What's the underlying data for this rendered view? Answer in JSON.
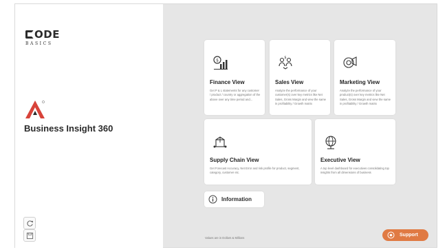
{
  "sidebar": {
    "logo_top": "ODE",
    "logo_bottom": "BASICS",
    "brand_title": "Business Insight 360"
  },
  "cards": {
    "finance": {
      "title": "Finance View",
      "description": "Get P & L statements for any customer / product / country or aggregation of the above over any time period and..."
    },
    "sales": {
      "title": "Sales View",
      "description": "Analyze the performance of your customer(s) over key metrics like Net Sales, Gross Margin and view the same in profitability / Growth matrix"
    },
    "marketing": {
      "title": "Marketing View",
      "description": "Analyze the performance of your product(s) over key metrics like Net Sales, Gross Margin and view the same in profitability / Growth matrix"
    },
    "supply_chain": {
      "title": "Supply Chain View",
      "description": "Get Forecast Accuracy, Net Error and risk profile for product, segment, category, customer etc."
    },
    "executive": {
      "title": "Executive View",
      "description": "A top level dashboard for executives consolidating top insights from all dimensions of business"
    }
  },
  "information": {
    "label": "Information"
  },
  "footnote": "Values are in Dollars & Millions",
  "support": {
    "label": "Support"
  },
  "colors": {
    "accent": "#e07a43",
    "brand_red": "#d8433a",
    "canvas": "#e6e6e6"
  },
  "icons": [
    "refresh-icon",
    "save-icon",
    "finance-chart-icon",
    "sales-people-icon",
    "marketing-megaphone-icon",
    "supply-chain-box-icon",
    "executive-globe-icon",
    "info-icon",
    "support-headset-icon"
  ]
}
